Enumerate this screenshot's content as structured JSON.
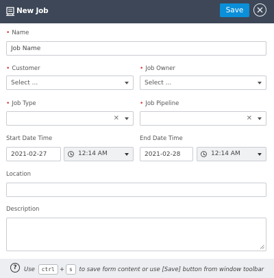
{
  "window": {
    "title": "New Job",
    "save_label": "Save"
  },
  "form": {
    "name": {
      "label": "Name",
      "value": "Job Name"
    },
    "customer": {
      "label": "Customer",
      "placeholder": "Select ..."
    },
    "job_owner": {
      "label": "Job Owner",
      "placeholder": "Select ..."
    },
    "job_type": {
      "label": "Job Type",
      "value": ""
    },
    "job_pipeline": {
      "label": "Job Pipeline",
      "value": ""
    },
    "start": {
      "label": "Start Date Time",
      "date": "2021-02-27",
      "time": "12:14 AM"
    },
    "end": {
      "label": "End Date Time",
      "date": "2021-02-28",
      "time": "12:14 AM"
    },
    "location": {
      "label": "Location",
      "value": ""
    },
    "description": {
      "label": "Description",
      "value": ""
    }
  },
  "footer": {
    "use": "Use",
    "key_ctrl": "ctrl",
    "plus": "+",
    "key_s": "s",
    "hint_rest": "to save form content or use [Save] button from window toolbar"
  },
  "colors": {
    "titlebar": "#3d4757",
    "accent": "#0a8fd8",
    "required": "#d9373c",
    "footer_bg": "#eceef1"
  }
}
